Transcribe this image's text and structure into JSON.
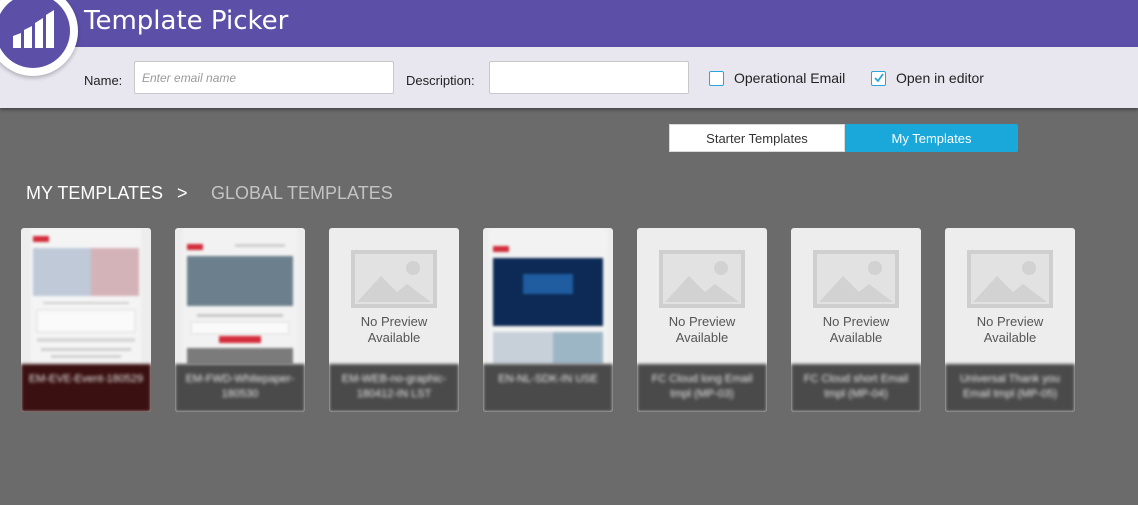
{
  "header": {
    "title": "Template Picker",
    "logo_icon": "marketo-logo-icon",
    "bar_color": "#5c4fa8"
  },
  "form": {
    "name_label": "Name:",
    "name_placeholder": "Enter email name",
    "name_value": "",
    "description_label": "Description:",
    "description_value": "",
    "operational_email_label": "Operational Email",
    "operational_email_checked": false,
    "open_in_editor_label": "Open in editor",
    "open_in_editor_checked": true
  },
  "toggle": {
    "starter_label": "Starter Templates",
    "mine_label": "My Templates",
    "selected": "My Templates",
    "accent": "#1aa7d9"
  },
  "breadcrumb": {
    "current": "MY TEMPLATES",
    "separator": ">",
    "other": "GLOBAL TEMPLATES"
  },
  "templates": [
    {
      "caption": "EM-EVE-Event-180529",
      "preview": "image"
    },
    {
      "caption": "EM-FWD-Whitepaper-180530",
      "preview": "image"
    },
    {
      "caption": "EM-WEB-no-graphic-180412-IN LST",
      "preview": "none",
      "no_preview_line1": "No Preview",
      "no_preview_line2": "Available"
    },
    {
      "caption": "EN-NL-SDK-IN USE",
      "preview": "image"
    },
    {
      "caption": "FC Cloud long Email tmpl (MP-03)",
      "preview": "none",
      "no_preview_line1": "No Preview",
      "no_preview_line2": "Available"
    },
    {
      "caption": "FC Cloud short Email tmpl (MP-04)",
      "preview": "none",
      "no_preview_line1": "No Preview",
      "no_preview_line2": "Available"
    },
    {
      "caption": "Universal Thank you Email tmpl (MP-05)",
      "preview": "none",
      "no_preview_line1": "No Preview",
      "no_preview_line2": "Available"
    }
  ]
}
